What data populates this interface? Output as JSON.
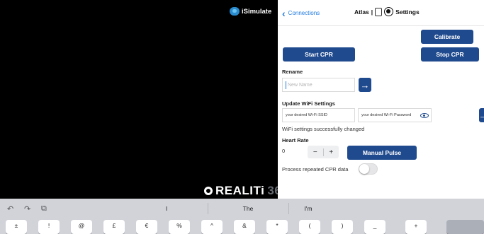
{
  "simulator": {
    "brand_label": "iSimulate",
    "watermark_text": "REALITi",
    "watermark_number": "360"
  },
  "panel": {
    "back_label": "Connections",
    "title_prefix": "Atlas",
    "title_separator": "|",
    "title_suffix": "Settings",
    "calibrate_label": "Calibrate",
    "start_cpr_label": "Start CPR",
    "stop_cpr_label": "Stop CPR",
    "rename_label": "Rename",
    "rename_placeholder": "New Name",
    "wifi_heading": "Update WiFi Settings",
    "wifi_ssid_value": "your desired Wi-Fi SSID",
    "wifi_password_value": "your desired Wi-Fi Password",
    "wifi_status": "WiFi settings successfully changed",
    "heart_rate_label": "Heart Rate",
    "heart_rate_value": "0",
    "stepper_minus": "−",
    "stepper_plus": "+",
    "manual_pulse_label": "Manual Pulse",
    "process_repeated_label": "Process repeated CPR data",
    "process_repeated_on": false,
    "submit_arrow": "→",
    "accent_color": "#1f4a8e",
    "link_color": "#1f7ae0"
  },
  "keyboard": {
    "undo_icon": "↶",
    "redo_icon": "↷",
    "paste_icon": "⧉",
    "suggestions": [
      "I",
      "The",
      "I'm"
    ],
    "keys": [
      "±",
      "!",
      "@",
      "£",
      "€",
      "%",
      "^",
      "&",
      "*",
      "(",
      ")",
      "_",
      "+"
    ]
  }
}
